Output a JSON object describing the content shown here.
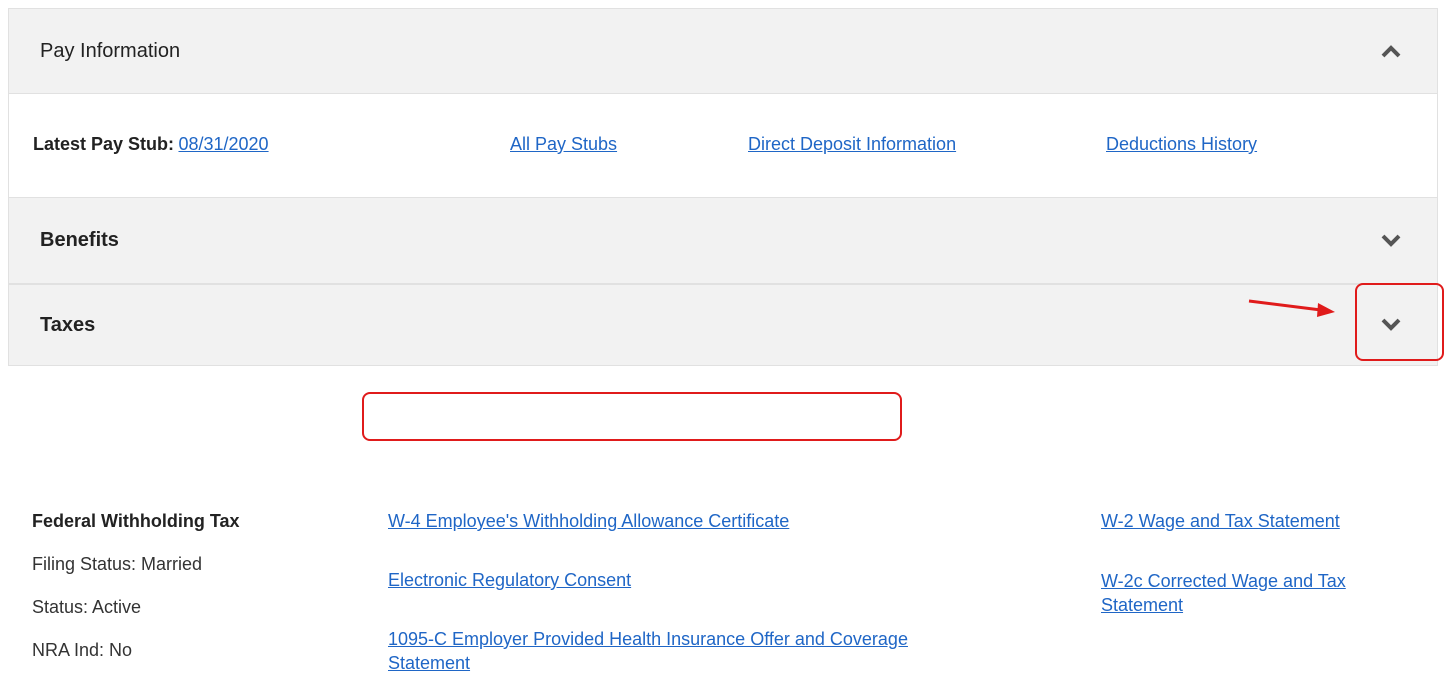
{
  "pay_information": {
    "title": "Pay Information",
    "latest_pay_stub_label": "Latest Pay Stub:",
    "latest_pay_stub_date": "08/31/2020",
    "links": {
      "all_pay_stubs": "All Pay Stubs",
      "direct_deposit": "Direct Deposit Information",
      "deductions_history": "Deductions History"
    },
    "expanded_icon": "chevron-up-icon"
  },
  "benefits": {
    "title": "Benefits",
    "icon": "chevron-down-icon"
  },
  "taxes": {
    "title": "Taxes",
    "icon": "chevron-down-icon",
    "federal": {
      "heading": "Federal Withholding Tax",
      "filing_status": "Filing Status: Married",
      "status": "Status: Active",
      "nra": "NRA Ind: No"
    },
    "links": {
      "w4": "W-4 Employee's Withholding Allowance Certificate",
      "consent": "Electronic Regulatory Consent",
      "form_1095c_line1": "1095-C Employer Provided Health Insurance Offer and Coverage",
      "form_1095c_line2": "Statement",
      "w2": "W-2 Wage and Tax Statement",
      "w2c_line1": "W-2c Corrected Wage and Tax",
      "w2c_line2": "Statement"
    }
  },
  "annotations": {
    "highlight_color": "#e01b1b"
  },
  "colors": {
    "link": "#1f66c6",
    "header_bg": "#f2f2f2"
  }
}
